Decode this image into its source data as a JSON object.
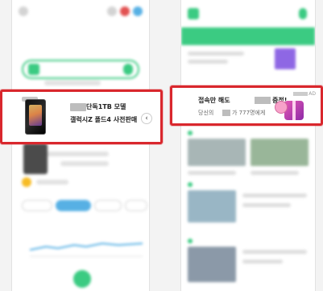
{
  "left_ad": {
    "line1": "단독1TB 모델",
    "line2": "갤럭시Z 폴드4 사전판매",
    "arrow_glyph": "‹"
  },
  "right_ad": {
    "line1_a": "접속만 해도",
    "line1_b": "증정!",
    "line2_a": "당신의",
    "line2_b": "가 777명에게",
    "ad_badge": "AD"
  },
  "colors": {
    "ad_border": "#d9272d",
    "brand_green": "#19c26d"
  }
}
